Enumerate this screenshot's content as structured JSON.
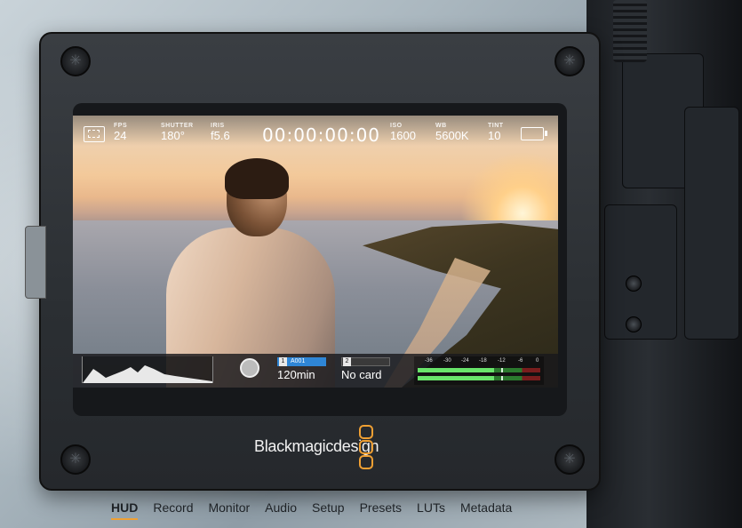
{
  "hud": {
    "fps": {
      "label": "FPS",
      "value": "24"
    },
    "shutter": {
      "label": "SHUTTER",
      "value": "180°"
    },
    "iris": {
      "label": "IRIS",
      "value": "f5.6"
    },
    "timecode": "00:00:00:00",
    "iso": {
      "label": "ISO",
      "value": "1600"
    },
    "wb": {
      "label": "WB",
      "value": "5600K"
    },
    "tint": {
      "label": "TINT",
      "value": "10"
    },
    "card1": {
      "slot": "1",
      "name": "A001",
      "remaining": "120min"
    },
    "card2": {
      "slot": "2",
      "name": "",
      "remaining": "No card"
    },
    "audio_scale": [
      "-36",
      "-30",
      "-24",
      "-18",
      "-12",
      "-6",
      "0"
    ],
    "audio_levels": [
      0.62,
      0.62
    ]
  },
  "brand": {
    "name": "Blackmagicdesign",
    "accent": "#f0a033"
  },
  "tabs": [
    {
      "label": "HUD",
      "active": true
    },
    {
      "label": "Record",
      "active": false
    },
    {
      "label": "Monitor",
      "active": false
    },
    {
      "label": "Audio",
      "active": false
    },
    {
      "label": "Setup",
      "active": false
    },
    {
      "label": "Presets",
      "active": false
    },
    {
      "label": "LUTs",
      "active": false
    },
    {
      "label": "Metadata",
      "active": false
    }
  ]
}
